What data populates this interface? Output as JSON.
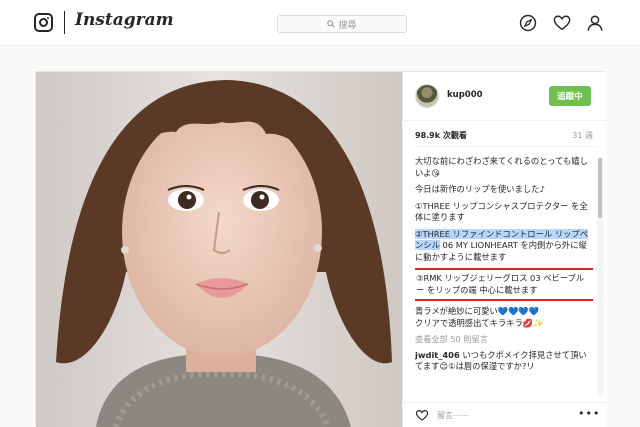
{
  "brand": {
    "wordmark": "Instagram"
  },
  "search": {
    "placeholder": "搜尋"
  },
  "post": {
    "username": "kup000",
    "follow_label": "追蹤中",
    "views": "98.9k 次觀看",
    "time": "31 週",
    "caption": [
      "大切な前にわざわざ来てくれるのとっても嬉しいよ😘",
      "今日は新作のリップを使いました♪",
      "①THREE リップコンシャスプロテクター を全体に塗ります"
    ],
    "step2": {
      "highlighted": "②THREE リファインドコントロール リップペンシル",
      "rest": " 06 MY LIONHEART を内側から外に縦に動かすように載せます"
    },
    "step3": "③RMK リップジェリーグロス 03 ベビーブルー をリップの端 中心に載せます",
    "extra": [
      "青ラメが絶妙に可愛い💙💙💙💙",
      "クリアで透明感出てキラキラ💋✨"
    ],
    "view_all": "查看全部 50 則留言",
    "comment": {
      "user": "jwdit_406",
      "text": "いつもクポメイク拝見させて頂いてます😊①は唇の保湿ですか?リ"
    },
    "comment_placeholder": "留言⋯⋯",
    "more_label": "•••"
  }
}
